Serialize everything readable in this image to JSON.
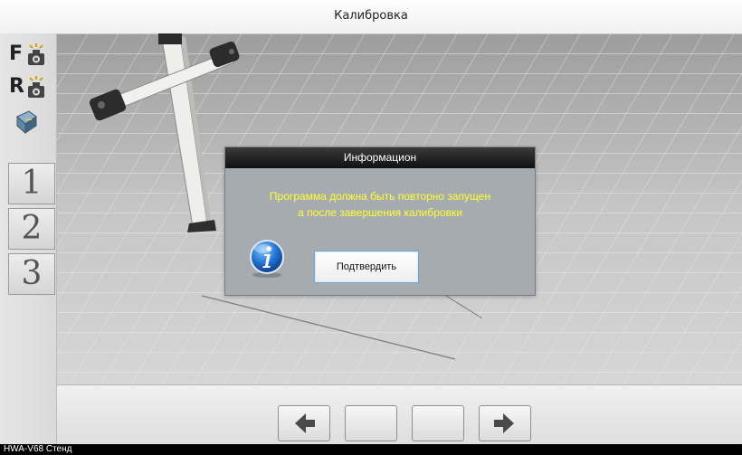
{
  "window": {
    "title": "Калибровка"
  },
  "sidebar": {
    "front_camera": {
      "letter": "F",
      "icon": "camera-icon"
    },
    "rear_camera": {
      "letter": "R",
      "icon": "camera-icon"
    },
    "tool_icon": "toolbox-icon",
    "steps": [
      {
        "label": "1"
      },
      {
        "label": "2"
      },
      {
        "label": "3"
      }
    ]
  },
  "dialog": {
    "title": "Информацион",
    "message_line1": "Программа должна быть повторно запущен",
    "message_line2": "а после завершения калибровки",
    "icon": "info-icon",
    "confirm_label": "Подтвердить"
  },
  "bottombar": {
    "buttons": [
      {
        "icon": "arrow-left-icon"
      },
      {
        "icon": ""
      },
      {
        "icon": ""
      },
      {
        "icon": "arrow-right-icon"
      }
    ]
  },
  "status": {
    "text": "HWA-V68  Стенд"
  },
  "colors": {
    "dialog_text": "#ffff33",
    "dialog_bg": "#a6abb0",
    "dialog_header": "#1a1a1a"
  }
}
